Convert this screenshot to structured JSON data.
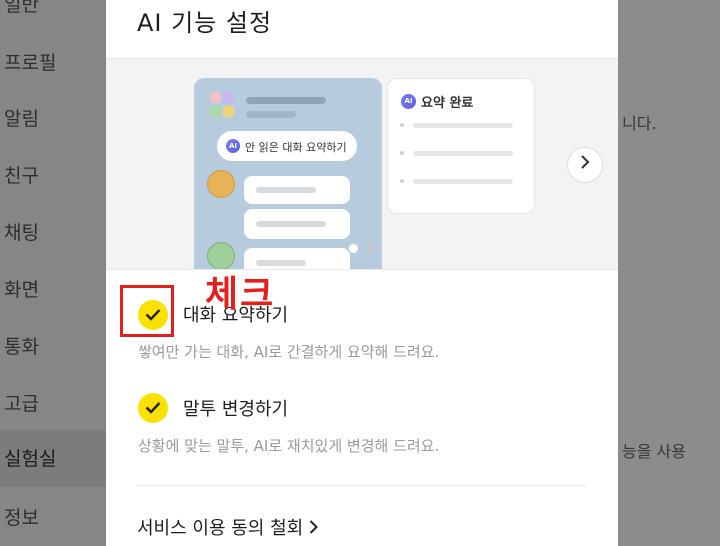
{
  "background": {
    "sidebar": [
      "일반",
      "프로필",
      "알림",
      "친구",
      "채팅",
      "화면",
      "통화",
      "고급",
      "실험실",
      "정보"
    ],
    "active_item": "실험실",
    "fragment_1": "니다.",
    "fragment_2": "능을 사용"
  },
  "modal": {
    "title": "AI 기능 설정",
    "preview": {
      "pill_text": "안 읽은 대화 요약하기",
      "ai_badge": "AI",
      "summary_title": "요약 완료",
      "next_icon": "chevron-right-icon"
    },
    "annotation": "체크",
    "options": [
      {
        "label": "대화 요약하기",
        "description": "쌓여만 가는 대화, AI로 간결하게 요약해 드려요.",
        "checked": true
      },
      {
        "label": "말투 변경하기",
        "description": "상황에 맞는 말투, AI로 재치있게 변경해 드려요.",
        "checked": true
      }
    ],
    "withdraw_label": "서비스 이용 동의 철회"
  },
  "colors": {
    "check": "#fae100",
    "annotation": "#e5201c",
    "ai_badge": "#6a6ee8"
  }
}
